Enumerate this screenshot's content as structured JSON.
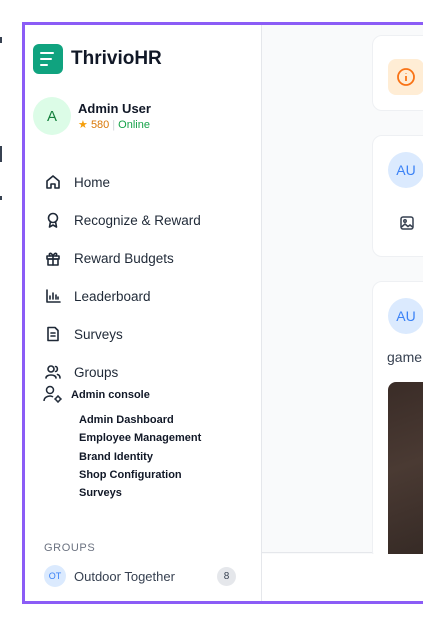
{
  "app": {
    "name": "ThrivioHR"
  },
  "user": {
    "initial": "A",
    "name": "Admin User",
    "points": "580",
    "status": "Online"
  },
  "nav": {
    "items": [
      {
        "label": "Home",
        "icon": "home-icon"
      },
      {
        "label": "Recognize & Reward",
        "icon": "award-icon"
      },
      {
        "label": "Reward Budgets",
        "icon": "gift-icon"
      },
      {
        "label": "Leaderboard",
        "icon": "bar-chart-icon"
      },
      {
        "label": "Surveys",
        "icon": "document-icon"
      },
      {
        "label": "Groups",
        "icon": "users-icon"
      }
    ]
  },
  "admin": {
    "label": "Admin console",
    "items": [
      "Admin Dashboard",
      "Employee Management",
      "Brand Identity",
      "Shop Configuration",
      "Surveys"
    ]
  },
  "groups": {
    "label": "GROUPS",
    "items": [
      {
        "initials": "OT",
        "name": "Outdoor Together",
        "count": "8"
      }
    ]
  },
  "feed": {
    "post1_initials": "AU",
    "post2_initials": "AU",
    "post2_text": "game"
  },
  "colors": {
    "accent": "#8b5cf6",
    "brand": "#10a37f",
    "online": "#16a34a",
    "info": "#f97316"
  }
}
